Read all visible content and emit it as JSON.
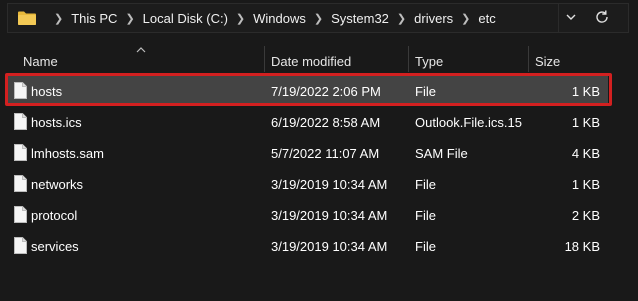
{
  "address_bar": {
    "path": [
      "This PC",
      "Local Disk (C:)",
      "Windows",
      "System32",
      "drivers",
      "etc"
    ]
  },
  "columns": {
    "name": "Name",
    "date": "Date modified",
    "type": "Type",
    "size": "Size"
  },
  "files": [
    {
      "name": "hosts",
      "date": "7/19/2022 2:06 PM",
      "type": "File",
      "size": "1 KB"
    },
    {
      "name": "hosts.ics",
      "date": "6/19/2022 8:58 AM",
      "type": "Outlook.File.ics.15",
      "size": "1 KB"
    },
    {
      "name": "lmhosts.sam",
      "date": "5/7/2022 11:07 AM",
      "type": "SAM File",
      "size": "4 KB"
    },
    {
      "name": "networks",
      "date": "3/19/2019 10:34 AM",
      "type": "File",
      "size": "1 KB"
    },
    {
      "name": "protocol",
      "date": "3/19/2019 10:34 AM",
      "type": "File",
      "size": "2 KB"
    },
    {
      "name": "services",
      "date": "3/19/2019 10:34 AM",
      "type": "File",
      "size": "18 KB"
    }
  ],
  "colors": {
    "background": "#191919",
    "selected_row": "#444444",
    "highlight_border": "#d32020",
    "folder_yellow": "#e8b93b"
  },
  "icons": {
    "folder": "folder-icon",
    "file": "file-icon",
    "chevron": "chevron-down-icon",
    "refresh": "refresh-icon"
  }
}
